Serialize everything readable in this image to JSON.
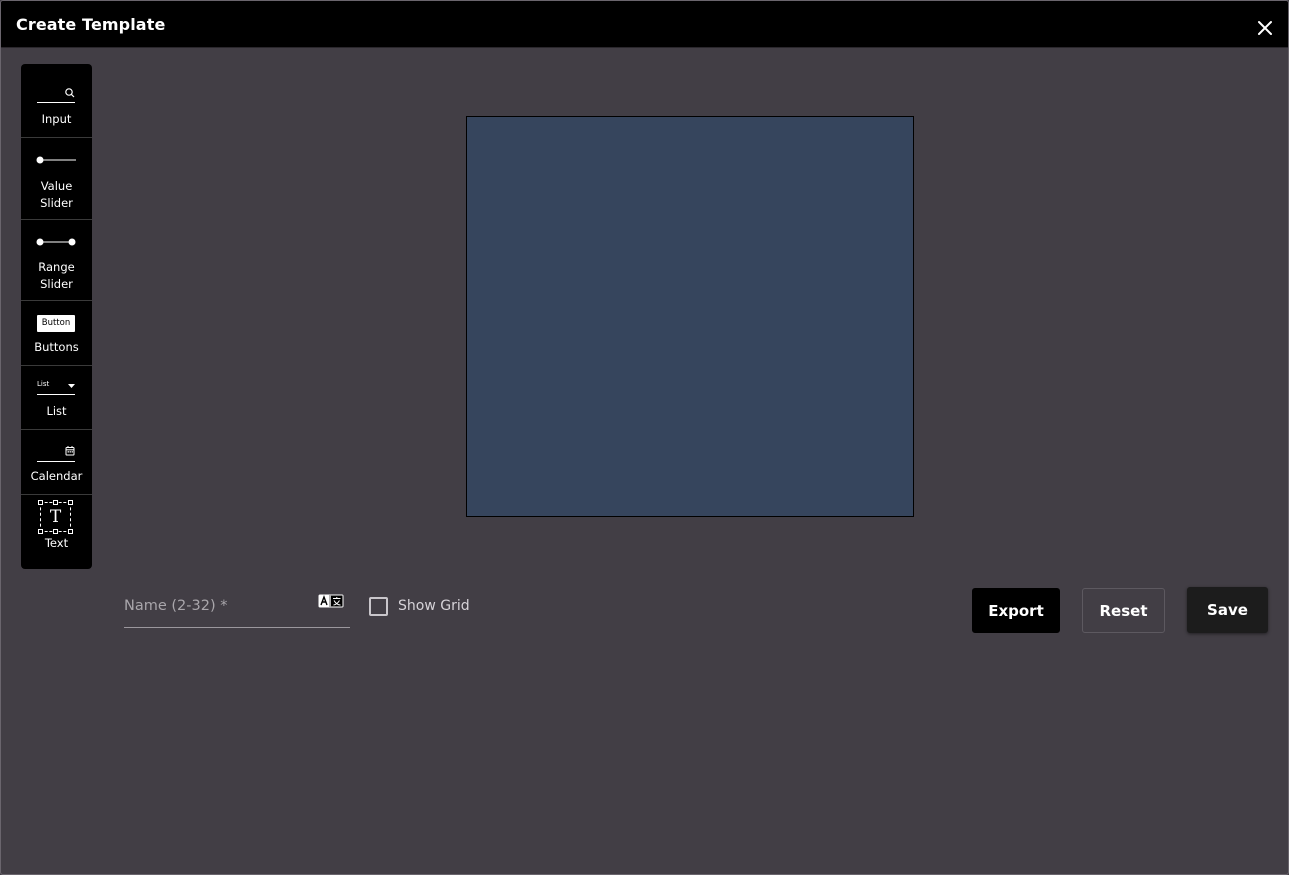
{
  "dialog": {
    "title": "Create Template"
  },
  "toolbar": {
    "items": [
      {
        "label": "Input",
        "icon": "search-input-icon"
      },
      {
        "label": "Value Slider",
        "icon": "value-slider-icon"
      },
      {
        "label": "Range Slider",
        "icon": "range-slider-icon"
      },
      {
        "label": "Buttons",
        "icon": "button-icon",
        "icon_text": "Button"
      },
      {
        "label": "List",
        "icon": "list-dropdown-icon",
        "icon_text": "List"
      },
      {
        "label": "Calendar",
        "icon": "calendar-icon"
      },
      {
        "label": "Text",
        "icon": "text-box-icon",
        "icon_text": "T"
      }
    ]
  },
  "canvas": {
    "background": "#36455d"
  },
  "form": {
    "name_placeholder": "Name (2-32) *",
    "name_value": "",
    "show_grid_label": "Show Grid",
    "show_grid_checked": false
  },
  "actions": {
    "export_label": "Export",
    "reset_label": "Reset",
    "save_label": "Save"
  },
  "colors": {
    "background": "#423e45",
    "titlebar": "#000000",
    "toolbar": "#000000",
    "canvas": "#36455d"
  }
}
